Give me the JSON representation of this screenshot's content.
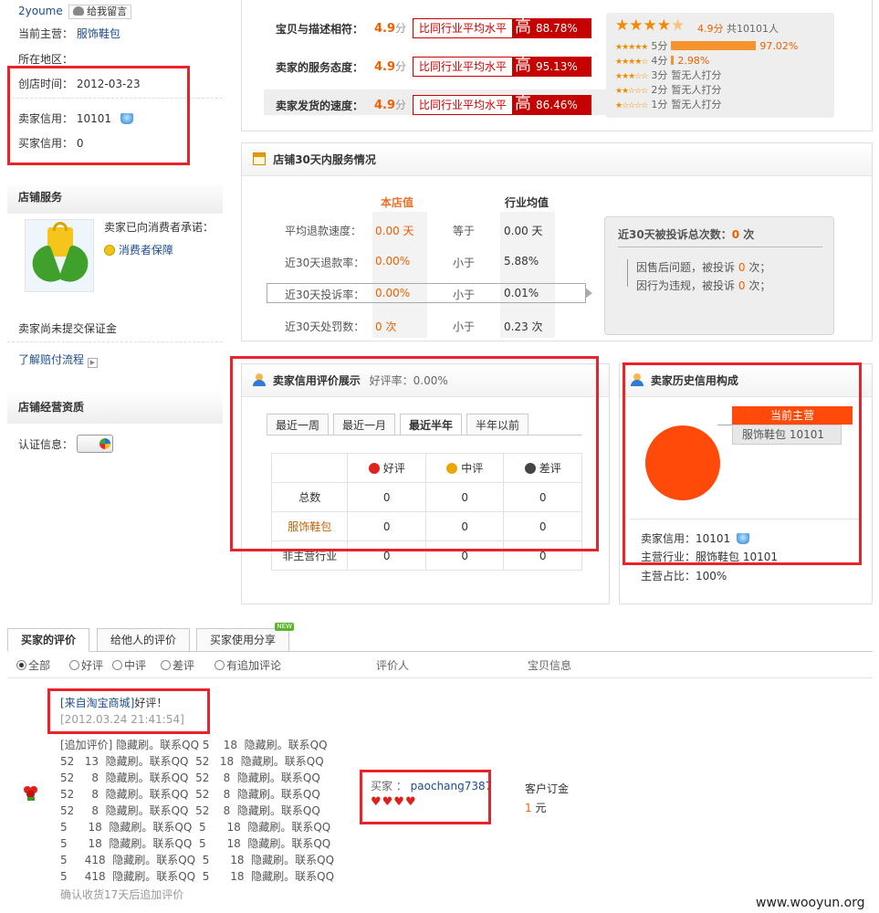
{
  "sidebar": {
    "seller_name": "2youme",
    "leave_message": "给我留言",
    "main_category_label": "当前主营：",
    "main_category_value": "服饰鞋包",
    "location_label": "所在地区：",
    "founded_label": "创店时间：",
    "founded_value": "2012-03-23",
    "seller_credit_label": "卖家信用：",
    "seller_credit_value": "10101",
    "buyer_credit_label": "买家信用：",
    "buyer_credit_value": "0",
    "store_service_title": "店铺服务",
    "promise_text": "卖家已向消费者承诺：",
    "consumer_protection": "消费者保障",
    "no_deposit": "卖家尚未提交保证金",
    "claim_process": "了解赔付流程",
    "qualification_title": "店铺经营资质",
    "cert_label": "认证信息："
  },
  "ratings": {
    "rows": [
      {
        "label": "宝贝与描述相符：",
        "score": "4.9",
        "unit": "分",
        "compare": "比同行业平均水平",
        "level": "高",
        "pct": "88.78%"
      },
      {
        "label": "卖家的服务态度：",
        "score": "4.9",
        "unit": "分",
        "compare": "比同行业平均水平",
        "level": "高",
        "pct": "95.13%"
      },
      {
        "label": "卖家发货的速度：",
        "score": "4.9",
        "unit": "分",
        "compare": "比同行业平均水平",
        "level": "高",
        "pct": "86.46%"
      }
    ],
    "summary_score": "4.9分",
    "summary_count": "共10101人",
    "distribution": [
      {
        "label": "5分",
        "pct": "97.02%",
        "value": 0.9702
      },
      {
        "label": "4分",
        "pct": "2.98%",
        "value": 0.0298
      },
      {
        "label": "3分",
        "pct": "暂无人打分",
        "value": 0
      },
      {
        "label": "2分",
        "pct": "暂无人打分",
        "value": 0
      },
      {
        "label": "1分",
        "pct": "暂无人打分",
        "value": 0
      }
    ]
  },
  "service30": {
    "title": "店铺30天内服务情况",
    "col_store": "本店值",
    "col_industry": "行业均值",
    "rows": [
      {
        "label": "平均退款速度：",
        "store": "0.00 天",
        "cmp": "等于",
        "industry": "0.00 天"
      },
      {
        "label": "近30天退款率：",
        "store": "0.00%",
        "cmp": "小于",
        "industry": "5.88%"
      },
      {
        "label": "近30天投诉率：",
        "store": "0.00%",
        "cmp": "小于",
        "industry": "0.01%"
      },
      {
        "label": "近30天处罚数：",
        "store": "0 次",
        "cmp": "小于",
        "industry": "0.23 次"
      }
    ],
    "complaint_title": "近30天被投诉总次数：",
    "complaint_total": "0",
    "complaint_unit": "次",
    "complaint_lines": [
      {
        "prefix": "因售后问题，被投诉",
        "count": "0",
        "suffix": "次；"
      },
      {
        "prefix": "因行为违规，被投诉",
        "count": "0",
        "suffix": "次；"
      }
    ]
  },
  "credit": {
    "title": "卖家信用评价展示",
    "good_rate": "好评率：0.00%",
    "tabs": [
      "最近一周",
      "最近一月",
      "最近半年",
      "半年以前"
    ],
    "active_tab": 2,
    "headers": [
      "",
      "好评",
      "中评",
      "差评"
    ],
    "rows": [
      {
        "label": "总数",
        "values": [
          "0",
          "0",
          "0"
        ]
      },
      {
        "label": "服饰鞋包",
        "values": [
          "0",
          "0",
          "0"
        ]
      },
      {
        "label": "非主营行业",
        "values": [
          "0",
          "0",
          "0"
        ]
      }
    ]
  },
  "history": {
    "title": "卖家历史信用构成",
    "current_main": "当前主营",
    "legend_item": "服饰鞋包 10101",
    "seller_credit": "卖家信用：10101",
    "main_industry": "主营行业：服饰鞋包  10101",
    "main_share": "主营占比：100%",
    "pie_color": "#ff4a0a"
  },
  "review_tabs": {
    "tabs": [
      "买家的评价",
      "给他人的评价",
      "买家使用分享"
    ],
    "new_badge": "NEW",
    "filters": [
      "全部",
      "好评",
      "中评",
      "差评",
      "有追加评论"
    ],
    "col_reviewer": "评价人",
    "col_item": "宝贝信息"
  },
  "review": {
    "source": "[来自淘宝商城]",
    "rating": "好评！",
    "time": "[2012.03.24 21:41:54]",
    "lines": [
      "[追加评价] 隐藏刷。联系QQ 5    18  隐藏刷。联系QQ",
      "52   13  隐藏刷。联系QQ  52   18  隐藏刷。联系QQ",
      "52     8  隐藏刷。联系QQ  52    8  隐藏刷。联系QQ",
      "52     8  隐藏刷。联系QQ  52    8  隐藏刷。联系QQ",
      "52     8  隐藏刷。联系QQ  52    8  隐藏刷。联系QQ",
      "5      18  隐藏刷。联系QQ  5      18  隐藏刷。联系QQ",
      "5      18  隐藏刷。联系QQ  5      18  隐藏刷。联系QQ",
      "5     418  隐藏刷。联系QQ  5      18  隐藏刷。联系QQ",
      "5     418  隐藏刷。联系QQ  5      18  隐藏刷。联系QQ"
    ],
    "confirm": "确认收货17天后追加评价",
    "buyer_label": "买家 ：",
    "buyer_name": "paochang7387",
    "item_name": "客户订金",
    "price": "1",
    "price_unit": "元"
  },
  "watermark": "www.wooyun.org"
}
